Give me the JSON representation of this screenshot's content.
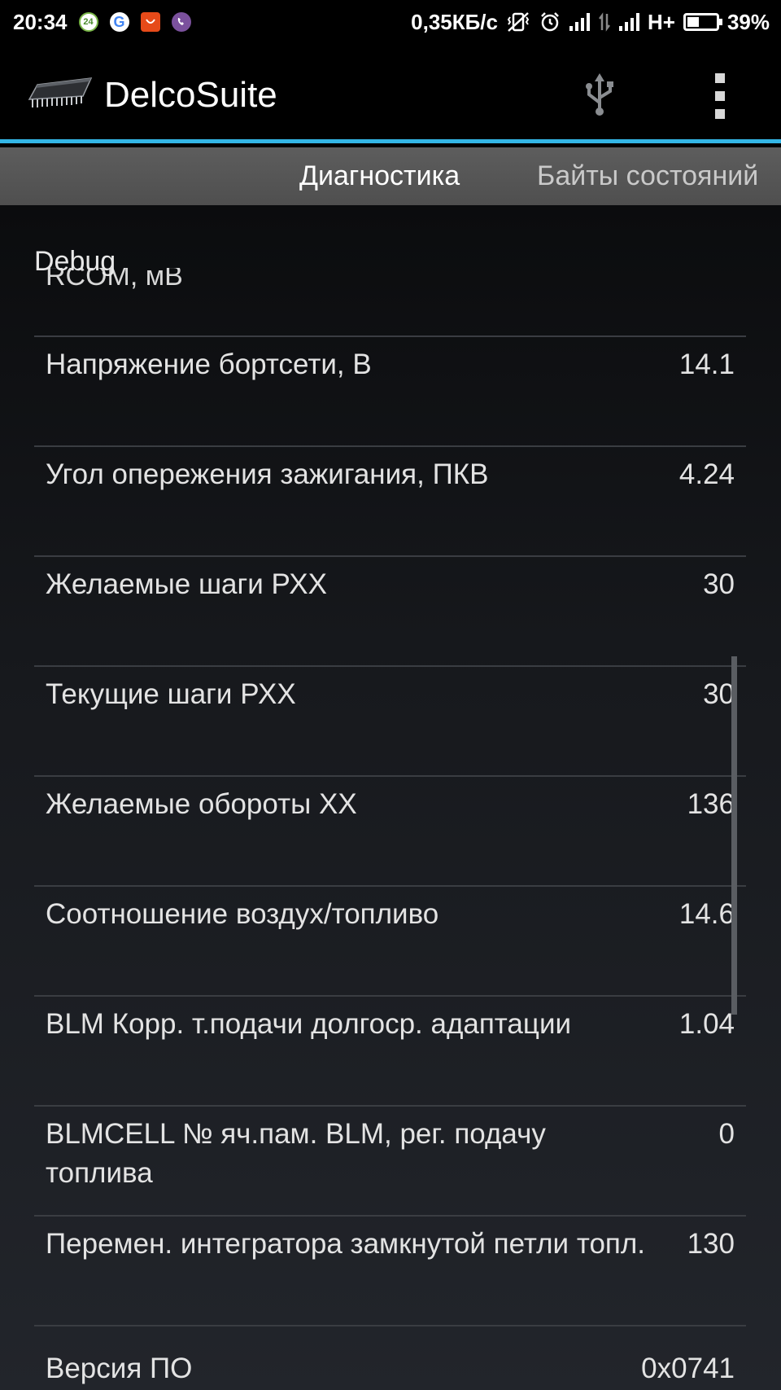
{
  "status_bar": {
    "time": "20:34",
    "notif_badge": "24",
    "speed": "0,35КБ/с",
    "network": "H+",
    "battery": "39%",
    "battery_level": 0.39,
    "icons": [
      "badge-24-icon",
      "google-icon",
      "aliexpress-icon",
      "viber-icon",
      "vibrate-icon",
      "alarm-icon",
      "signal-icon",
      "data-arrows-icon",
      "signal-icon",
      "battery-icon"
    ]
  },
  "app_bar": {
    "title": "DelcoSuite",
    "accent_color": "#33b5e5",
    "icons": [
      "chip-icon",
      "usb-icon",
      "overflow-menu-icon"
    ]
  },
  "tabs": [
    {
      "label": "Диагностика",
      "active": true
    },
    {
      "label": "Байты состояний",
      "active": false
    }
  ],
  "section": {
    "label": "Debug"
  },
  "partial_top_row": {
    "label": "RCOM, мВ"
  },
  "rows": [
    {
      "label": "Напряжение бортсети, В",
      "value": "14.1"
    },
    {
      "label": "Угол опережения зажигания, ПКВ",
      "value": "4.24"
    },
    {
      "label": "Желаемые шаги РХХ",
      "value": "30"
    },
    {
      "label": "Текущие шаги РХХ",
      "value": "30"
    },
    {
      "label": "Желаемые обороты ХХ",
      "value": "136"
    },
    {
      "label": "Соотношение воздух/топливо",
      "value": "14.6"
    },
    {
      "label": "BLM Корр. т.подачи долгоср. адаптации",
      "value": "1.04"
    },
    {
      "label": "BLMCELL № яч.пам. BLM, рег. подачу топлива",
      "value": "0"
    },
    {
      "label": "Перемен. интегратора замкнутой петли топл.",
      "value": "130"
    }
  ],
  "partial_bottom_row": {
    "label": "Версия ПО",
    "value": "0x0741"
  }
}
